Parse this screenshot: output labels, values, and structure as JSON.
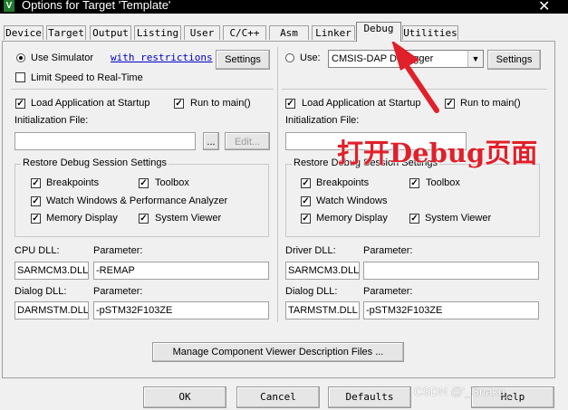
{
  "window": {
    "title": "Options for Target 'Template'",
    "app_icon_letter": "V",
    "close_glyph": "✕"
  },
  "tabs": [
    "Device",
    "Target",
    "Output",
    "Listing",
    "User",
    "C/C++",
    "Asm",
    "Linker",
    "Debug",
    "Utilities"
  ],
  "active_tab": "Debug",
  "left": {
    "use_simulator_label": "Use Simulator",
    "restrictions_link": "with restrictions",
    "settings_label": "Settings",
    "limit_speed_label": "Limit Speed to Real-Time",
    "load_app_label": "Load Application at Startup",
    "run_to_main_label": "Run to main()",
    "init_file_label": "Initialization File:",
    "init_file_value": "",
    "browse_label": "...",
    "edit_label": "Edit...",
    "restore_group_title": "Restore Debug Session Settings",
    "breakpoints_label": "Breakpoints",
    "toolbox_label": "Toolbox",
    "watch_label": "Watch Windows & Performance Analyzer",
    "memory_label": "Memory Display",
    "system_viewer_label": "System Viewer",
    "cpu_dll_label": "CPU DLL:",
    "cpu_dll_value": "SARMCM3.DLL",
    "cpu_param_label": "Parameter:",
    "cpu_param_value": "-REMAP",
    "dialog_dll_label": "Dialog DLL:",
    "dialog_dll_value": "DARMSTM.DLL",
    "dialog_param_label": "Parameter:",
    "dialog_param_value": "-pSTM32F103ZE"
  },
  "right": {
    "use_label": "Use:",
    "debugger_value": "CMSIS-DAP Debugger",
    "settings_label": "Settings",
    "load_app_label": "Load Application at Startup",
    "run_to_main_label": "Run to main()",
    "init_file_label": "Initialization File:",
    "init_file_value": "",
    "restore_group_title": "Restore Debug Session Settings",
    "breakpoints_label": "Breakpoints",
    "toolbox_label": "Toolbox",
    "watch_label": "Watch Windows",
    "memory_label": "Memory Display",
    "system_viewer_label": "System Viewer",
    "driver_dll_label": "Driver DLL:",
    "driver_dll_value": "SARMCM3.DLL",
    "driver_param_label": "Parameter:",
    "driver_param_value": "",
    "dialog_dll_label": "Dialog DLL:",
    "dialog_dll_value": "TARMSTM.DLL",
    "dialog_param_label": "Parameter:",
    "dialog_param_value": "-pSTM32F103ZE"
  },
  "manage_button_label": "Manage Component Viewer Description Files ...",
  "footer": {
    "ok": "OK",
    "cancel": "Cancel",
    "defaults": "Defaults",
    "help": "Help"
  },
  "annotation": {
    "text": "打开Debug页面",
    "color": "#e0202a"
  },
  "watermark": "CSDN @'_Snake_",
  "check_glyph": "✓",
  "dropdown_glyph": "▼"
}
